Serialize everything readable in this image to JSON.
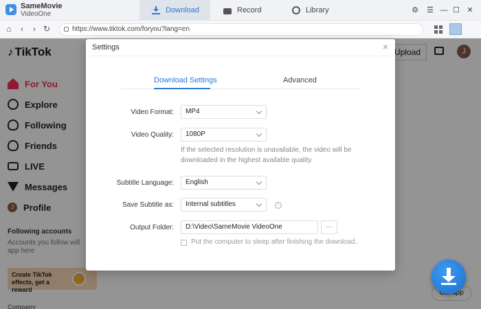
{
  "app": {
    "name": "SameMovie",
    "sub": "VideoOne"
  },
  "tabs": {
    "download": "Download",
    "record": "Record",
    "library": "Library"
  },
  "url": "https://www.tiktok.com/foryou?lang=en",
  "tiktok": {
    "logo": "TikTok",
    "upload": "Upload",
    "avatar": "J",
    "nav": [
      "For You",
      "Explore",
      "Following",
      "Friends",
      "LIVE",
      "Messages",
      "Profile"
    ],
    "following_title": "Following accounts",
    "following_desc": "Accounts you follow will app here",
    "effects": "Create TikTok effects, get a reward",
    "company": "Company",
    "getapp": "Get app"
  },
  "settings": {
    "title": "Settings",
    "close": "×",
    "tab_download": "Download Settings",
    "tab_advanced": "Advanced",
    "video_format_label": "Video Format:",
    "video_format": "MP4",
    "video_quality_label": "Video Quality:",
    "video_quality": "1080P",
    "quality_hint": "If the selected resolution is unavailable, the video will be downloaded in the highest available quality.",
    "subtitle_language_label": "Subtitle Language:",
    "subtitle_language": "English",
    "save_subtitle_label": "Save Subtitle as:",
    "save_subtitle": "Internal subtitles",
    "output_folder_label": "Output Folder:",
    "output_folder": "D:\\Video\\SameMovie VideoOne",
    "more": "···",
    "sleep_label": "Put the computer to sleep after finishing the download.."
  }
}
